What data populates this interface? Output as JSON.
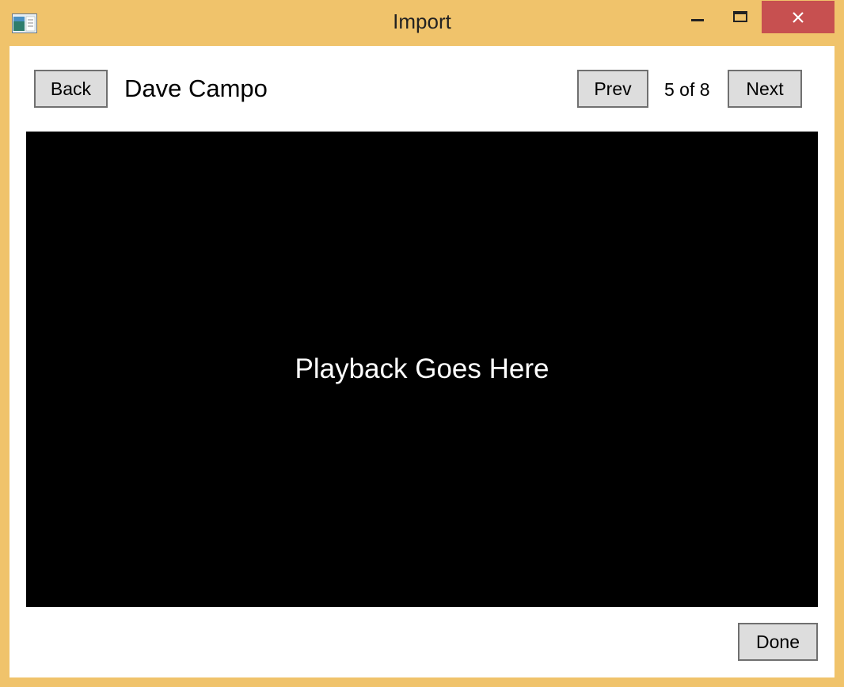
{
  "window": {
    "title": "Import",
    "frame_color": "#f0c36b",
    "close_color": "#c75050"
  },
  "controls": {
    "minimize_icon": "minimize-icon",
    "maximize_icon": "maximize-icon",
    "close_icon": "close-icon"
  },
  "header": {
    "back_label": "Back",
    "person_name": "Dave Campo",
    "prev_label": "Prev",
    "counter": "5 of 8",
    "next_label": "Next"
  },
  "playback": {
    "placeholder": "Playback Goes Here"
  },
  "footer": {
    "done_label": "Done"
  }
}
